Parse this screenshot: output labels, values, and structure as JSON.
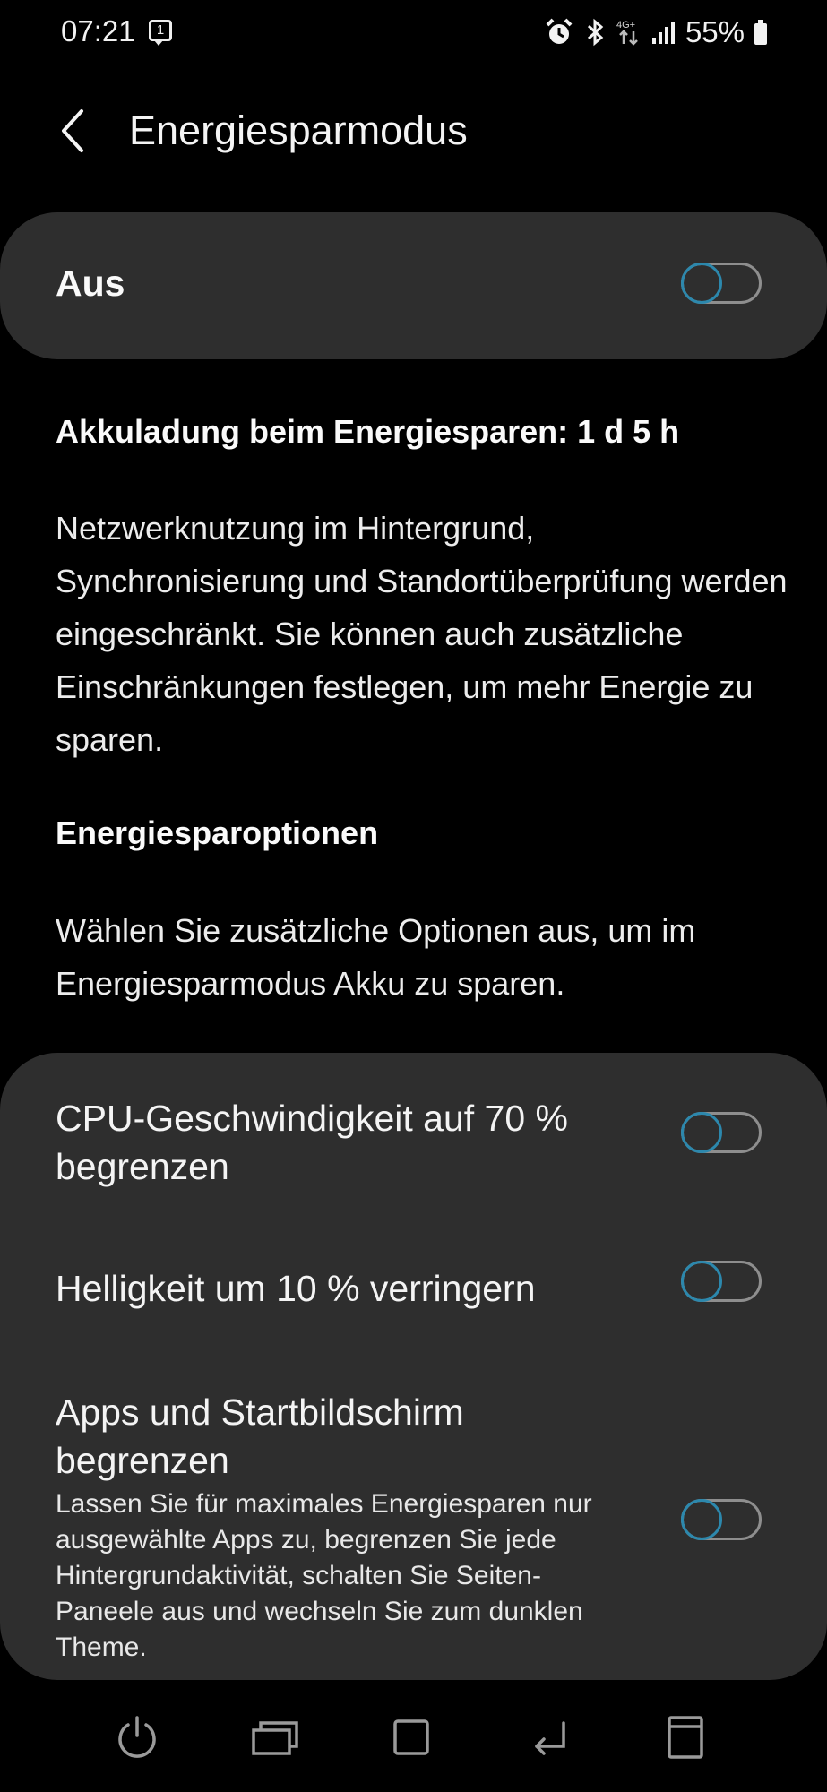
{
  "status_bar": {
    "time": "07:21",
    "notification_count": "1",
    "network_type": "4G+",
    "battery_percent": "55%",
    "icons": [
      "alarm-icon",
      "bluetooth-icon",
      "mobile-data-icon",
      "signal-icon",
      "battery-icon"
    ]
  },
  "header": {
    "title": "Energiesparmodus"
  },
  "master_switch": {
    "label": "Aus",
    "enabled": false
  },
  "battery_estimate": "Akkuladung beim Energiesparen: 1 d 5 h",
  "description": "Netzwerknutzung im Hintergrund, Synchronisierung und Standortüberprüfung werden eingeschränkt. Sie können auch zusätzliche Einschränkungen festlegen, um mehr Energie zu sparen.",
  "options_section": {
    "heading": "Energiesparoptionen",
    "description": "Wählen Sie zusätzliche Optionen aus, um im Energiesparmodus Akku zu sparen.",
    "items": [
      {
        "label": "CPU-Geschwindigkeit auf 70 % begrenzen",
        "enabled": false
      },
      {
        "label": "Helligkeit um 10 % verringern",
        "enabled": false
      },
      {
        "label": "Apps und Startbildschirm begrenzen",
        "sublabel": "Lassen Sie für maximales Energiesparen nur ausgewählte Apps zu, begrenzen Sie jede Hintergrundaktivität, schalten Sie Seiten-Paneele aus und wechseln Sie zum dunklen Theme.",
        "enabled": false
      }
    ]
  },
  "nav_bar": {
    "icons": [
      "power-icon",
      "recent-apps-icon",
      "home-icon",
      "back-icon",
      "app-drawer-icon"
    ]
  },
  "colors": {
    "background": "#000000",
    "card": "#2e2e2e",
    "toggle_knob": "#2c88ad",
    "toggle_track": "#8e8e8e"
  }
}
